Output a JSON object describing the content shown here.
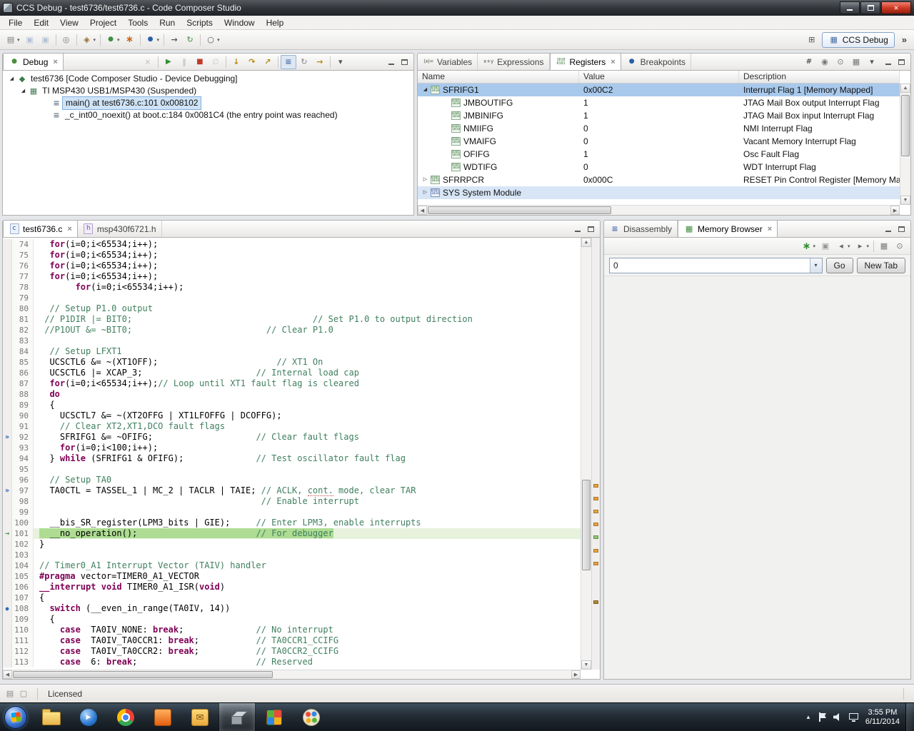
{
  "window": {
    "title": "CCS Debug - test6736/test6736.c - Code Composer Studio"
  },
  "menu_bar": [
    "File",
    "Edit",
    "View",
    "Project",
    "Tools",
    "Run",
    "Scripts",
    "Window",
    "Help"
  ],
  "main_toolbar": {
    "perspective_label": "CCS Debug",
    "overflow": "»",
    "groups": [
      [
        {
          "name": "new-button",
          "dropdown": true
        },
        {
          "name": "save-button",
          "disabled": true
        },
        {
          "name": "save-all-button",
          "disabled": true
        }
      ],
      [
        {
          "name": "new-target-config-button"
        }
      ],
      [
        {
          "name": "build-button",
          "dropdown": true
        }
      ],
      [
        {
          "name": "debug-button",
          "dropdown": true
        },
        {
          "name": "flash-button"
        }
      ],
      [
        {
          "name": "breakpoint-button",
          "dropdown": true
        }
      ],
      [
        {
          "name": "connect-target-button"
        },
        {
          "name": "refresh-button"
        }
      ],
      [
        {
          "name": "search-button",
          "dropdown": true
        }
      ]
    ]
  },
  "colors": {
    "selection_blue": "#a8c9ec",
    "pc_line_green": "#aedc92",
    "comment_green": "#3f7f5f",
    "keyword_maroon": "#7f0055"
  },
  "debug_panel": {
    "tabs": [
      {
        "label": "Debug",
        "icon": "bug-icon",
        "active": true
      }
    ],
    "toolbar": [
      {
        "name": "remove-all-button",
        "disabled": true
      },
      "sep",
      {
        "name": "resume-button"
      },
      {
        "name": "suspend-button",
        "disabled": true
      },
      {
        "name": "terminate-button"
      },
      {
        "name": "disconnect-button",
        "disabled": true
      },
      "sep",
      {
        "name": "step-into-button"
      },
      {
        "name": "step-over-button"
      },
      {
        "name": "step-return-button"
      },
      "sep",
      {
        "name": "asm-step-button",
        "pressed": true
      },
      {
        "name": "restart-button"
      },
      {
        "name": "run-to-line-button"
      },
      "sep",
      {
        "name": "view-menu-button"
      }
    ],
    "tree": [
      {
        "indent": 0,
        "twisty": "open",
        "icon": "debug-session-icon",
        "label": "test6736 [Code Composer Studio - Device Debugging]"
      },
      {
        "indent": 1,
        "twisty": "open",
        "icon": "device-icon",
        "label": "TI MSP430 USB1/MSP430 (Suspended)"
      },
      {
        "indent": 3,
        "twisty": "none",
        "icon": "stack-frame-icon",
        "label": "main() at test6736.c:101 0x008102",
        "selected": true
      },
      {
        "indent": 3,
        "twisty": "none",
        "icon": "stack-frame-icon",
        "label": "_c_int00_noexit() at boot.c:184 0x0081C4  (the entry point was reached)"
      }
    ]
  },
  "registers_panel": {
    "tabs": [
      {
        "label": "Variables",
        "icon": "variables-icon"
      },
      {
        "label": "Expressions",
        "icon": "expressions-icon"
      },
      {
        "label": "Registers",
        "icon": "registers-icon",
        "active": true
      },
      {
        "label": "Breakpoints",
        "icon": "breakpoints-icon"
      }
    ],
    "toolbar": [
      {
        "name": "number-format-button"
      },
      {
        "name": "snapshot-button"
      },
      {
        "name": "pin-button"
      },
      {
        "name": "layout-button"
      },
      {
        "name": "view-menu-button"
      }
    ],
    "columns": [
      "Name",
      "Value",
      "Description"
    ],
    "rows": [
      {
        "name": "SFRIFG1",
        "value": "0x00C2",
        "description": "Interrupt Flag 1 [Memory Mapped]",
        "level": 0,
        "twisty": "open",
        "selected": true
      },
      {
        "name": "JMBOUTIFG",
        "value": "1",
        "description": "JTAG Mail Box output Interrupt Flag",
        "level": 1
      },
      {
        "name": "JMBINIFG",
        "value": "1",
        "description": "JTAG Mail Box input Interrupt Flag",
        "level": 1
      },
      {
        "name": "NMIIFG",
        "value": "0",
        "description": "NMI Interrupt Flag",
        "level": 1
      },
      {
        "name": "VMAIFG",
        "value": "0",
        "description": "Vacant Memory Interrupt Flag",
        "level": 1
      },
      {
        "name": "OFIFG",
        "value": "1",
        "description": "Osc Fault Flag",
        "level": 1
      },
      {
        "name": "WDTIFG",
        "value": "0",
        "description": "WDT Interrupt Flag",
        "level": 1
      },
      {
        "name": "SFRRPCR",
        "value": "0x000C",
        "description": "RESET Pin Control Register [Memory Ma",
        "level": 0,
        "twisty": "closed"
      },
      {
        "name": "SYS  System Module",
        "value": "",
        "description": "",
        "level": 0,
        "twisty": "closed",
        "group": true
      }
    ]
  },
  "editor": {
    "tabs": [
      {
        "label": "test6736.c",
        "icon": "c-file-icon",
        "active": true
      },
      {
        "label": "msp430f6721.h",
        "icon": "h-file-icon"
      }
    ],
    "current_line": 101,
    "markers": {
      "92": "chevron",
      "97": "chevron",
      "101": "pc",
      "108": "breakpoint"
    },
    "overview_marks": [
      {
        "pos": 57,
        "color": "#e8a33d"
      },
      {
        "pos": 60,
        "color": "#e8a33d"
      },
      {
        "pos": 63,
        "color": "#e8a33d"
      },
      {
        "pos": 66,
        "color": "#e8a33d"
      },
      {
        "pos": 69,
        "color": "#8fc76f"
      },
      {
        "pos": 72,
        "color": "#e8a33d"
      },
      {
        "pos": 75,
        "color": "#e8a33d"
      },
      {
        "pos": 84,
        "color": "#b08830"
      }
    ],
    "lines": [
      {
        "n": 74,
        "t": "  for(i=0;i<65534;i++);"
      },
      {
        "n": 75,
        "t": "  for(i=0;i<65534;i++);"
      },
      {
        "n": 76,
        "t": "  for(i=0;i<65534;i++);"
      },
      {
        "n": 77,
        "t": "  for(i=0;i<65534;i++);"
      },
      {
        "n": 78,
        "t": "       for(i=0;i<65534;i++);"
      },
      {
        "n": 79,
        "t": ""
      },
      {
        "n": 80,
        "t": "  // Setup P1.0 output"
      },
      {
        "n": 81,
        "t": " // P1DIR |= BIT0;                                   // Set P1.0 to output direction"
      },
      {
        "n": 82,
        "t": " //P1OUT &= ~BIT0;                          // Clear P1.0"
      },
      {
        "n": 83,
        "t": ""
      },
      {
        "n": 84,
        "t": "  // Setup LFXT1"
      },
      {
        "n": 85,
        "t": "  UCSCTL6 &= ~(XT1OFF);                       // XT1 On"
      },
      {
        "n": 86,
        "t": "  UCSCTL6 |= XCAP_3;                      // Internal load cap"
      },
      {
        "n": 87,
        "t": "  for(i=0;i<65534;i++);// Loop until XT1 fault flag is cleared"
      },
      {
        "n": 88,
        "t": "  do"
      },
      {
        "n": 89,
        "t": "  {"
      },
      {
        "n": 90,
        "t": "    UCSCTL7 &= ~(XT2OFFG | XT1LFOFFG | DCOFFG);"
      },
      {
        "n": 91,
        "t": "    // Clear XT2,XT1,DCO fault flags"
      },
      {
        "n": 92,
        "t": "    SFRIFG1 &= ~OFIFG;                    // Clear fault flags"
      },
      {
        "n": 93,
        "t": "    for(i=0;i<100;i++);"
      },
      {
        "n": 94,
        "t": "  } while (SFRIFG1 & OFIFG);              // Test oscillator fault flag"
      },
      {
        "n": 95,
        "t": ""
      },
      {
        "n": 96,
        "t": "  // Setup TA0"
      },
      {
        "n": 97,
        "t": "  TA0CTL = TASSEL_1 | MC_2 | TACLR | TAIE; // ACLK, cont. mode, clear TAR"
      },
      {
        "n": 98,
        "t": "                                           // Enable interrupt"
      },
      {
        "n": 99,
        "t": ""
      },
      {
        "n": 100,
        "t": "  __bis_SR_register(LPM3_bits | GIE);     // Enter LPM3, enable interrupts"
      },
      {
        "n": 101,
        "t": "  __no_operation();                       // For debugger"
      },
      {
        "n": 102,
        "t": "}"
      },
      {
        "n": 103,
        "t": ""
      },
      {
        "n": 104,
        "t": "// Timer0_A1 Interrupt Vector (TAIV) handler"
      },
      {
        "n": 105,
        "t": "#pragma vector=TIMER0_A1_VECTOR"
      },
      {
        "n": 106,
        "t": "__interrupt void TIMER0_A1_ISR(void)"
      },
      {
        "n": 107,
        "t": "{"
      },
      {
        "n": 108,
        "t": "  switch (__even_in_range(TA0IV, 14))"
      },
      {
        "n": 109,
        "t": "  {"
      },
      {
        "n": 110,
        "t": "    case  TA0IV_NONE: break;              // No interrupt"
      },
      {
        "n": 111,
        "t": "    case  TA0IV_TA0CCR1: break;           // TA0CCR1_CCIFG"
      },
      {
        "n": 112,
        "t": "    case  TA0IV_TA0CCR2: break;           // TA0CCR2_CCIFG"
      },
      {
        "n": 113,
        "t": "    case  6: break;                       // Reserved"
      }
    ]
  },
  "memory_panel": {
    "tabs": [
      {
        "label": "Disassembly",
        "icon": "disassembly-icon"
      },
      {
        "label": "Memory Browser",
        "icon": "memory-browser-icon",
        "active": true
      }
    ],
    "toolbar": [
      {
        "name": "new-rendering-button",
        "dropdown": true
      },
      {
        "name": "save-memory-button"
      },
      {
        "name": "back-button",
        "dropdown": true
      },
      {
        "name": "forward-button",
        "dropdown": true
      },
      "sep",
      {
        "name": "table-format-button"
      },
      {
        "name": "pin-memory-button"
      }
    ],
    "address_value": "0",
    "go_label": "Go",
    "new_tab_label": "New Tab"
  },
  "status_bar": {
    "license": "Licensed"
  },
  "taskbar": {
    "icons": [
      {
        "name": "explorer-icon",
        "art": "explorer"
      },
      {
        "name": "media-player-icon",
        "art": "wmp"
      },
      {
        "name": "chrome-icon",
        "art": "chrome"
      },
      {
        "name": "app-orange-icon",
        "art": "orangeapp"
      },
      {
        "name": "outlook-icon",
        "art": "outlook"
      },
      {
        "name": "ccs-taskbar-icon",
        "art": "ccs",
        "active": true
      },
      {
        "name": "tiles-app-icon",
        "art": "tiles"
      },
      {
        "name": "paint-icon",
        "art": "paint"
      }
    ],
    "clock": {
      "time": "3:55 PM",
      "date": "6/11/2014"
    }
  }
}
